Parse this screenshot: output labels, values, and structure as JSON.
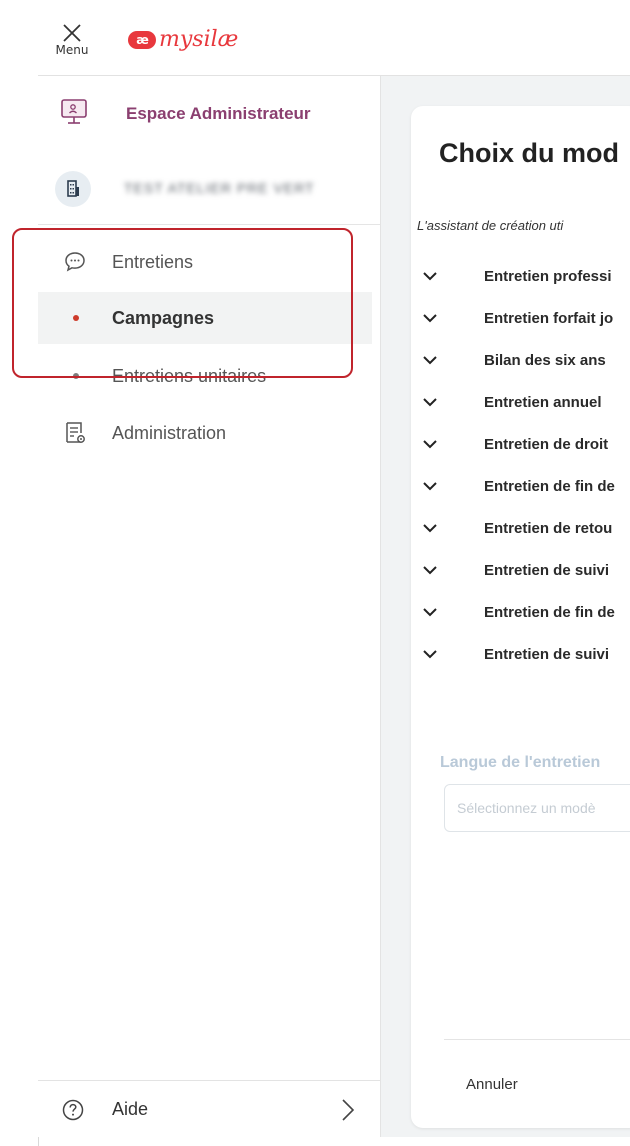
{
  "header": {
    "menu_label": "Menu",
    "logo_mark": "æ",
    "logo_text": "mysilæ",
    "brand_color": "#e8383d"
  },
  "sidebar": {
    "space_label": "Espace Administrateur",
    "org_name": "TEST ATELIER PRE VERT",
    "nav": [
      {
        "label": "Entretiens",
        "icon": "chat-bubble-icon"
      },
      {
        "label": "Campagnes",
        "active": true
      },
      {
        "label": "Entretiens unitaires"
      },
      {
        "label": "Administration",
        "icon": "document-gear-icon"
      }
    ],
    "help_label": "Aide",
    "accent_color": "#8b3f70",
    "highlight_color": "#c0242c"
  },
  "card": {
    "title": "Choix du mod",
    "intro": "L'assistant de création uti",
    "models": [
      "Entretien professi",
      "Entretien forfait jo",
      "Bilan des six ans",
      "Entretien annuel",
      "Entretien de droit",
      "Entretien de fin de",
      "Entretien de retou",
      "Entretien de suivi",
      "Entretien de fin de",
      "Entretien de suivi"
    ],
    "language_label": "Langue de l'entretien",
    "language_placeholder": "Sélectionnez un modè",
    "cancel_label": "Annuler"
  }
}
